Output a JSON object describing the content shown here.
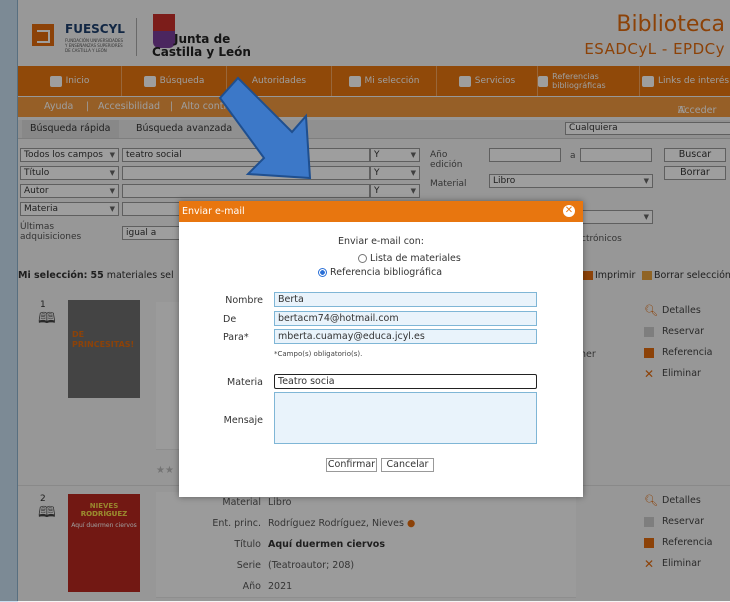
{
  "header": {
    "fues_name": "FUESCYL",
    "fues_sub": "FUNDACIÓN UNIVERSIDADES Y ENSEÑANZAS SUPERIORES DE CASTILLA Y LEÓN",
    "jcyl_line1": "Junta de",
    "jcyl_line2": "Castilla y León",
    "title": "Biblioteca",
    "subtitle": "ESADCyL - EPDCy"
  },
  "nav": {
    "items": [
      {
        "label": "Inicio",
        "icon": "home-icon"
      },
      {
        "label": "Búsqueda",
        "icon": "search-icon"
      },
      {
        "label": "Autoridades",
        "icon": "user-icon"
      },
      {
        "label": "Mi selección",
        "icon": "basket-icon"
      },
      {
        "label": "Servicios",
        "icon": "services-icon"
      },
      {
        "label": "Referencias bibliográficas",
        "icon": "books-icon"
      },
      {
        "label": "Links de interés",
        "icon": "globe-icon"
      }
    ]
  },
  "subnav": {
    "help": "Ayuda",
    "access": "Accesibilidad",
    "contrast": "Alto contraste",
    "login": "Acceder"
  },
  "search": {
    "tab_quick": "Búsqueda rápida",
    "tab_advanced": "Búsqueda avanzada",
    "quick_select": "Cualquiera",
    "fields": [
      "Todos los campos",
      "Título",
      "Autor",
      "Materia"
    ],
    "first_value": "teatro social",
    "op": "Y",
    "year_label": "Año edición",
    "year_sep": "a",
    "material_label": "Material",
    "material_value": "Libro",
    "search_button": "Buscar",
    "clear_button": "Borrar",
    "recent_label": "Últimas adquisiciones",
    "recent_value": "igual a",
    "electronic_partial": "ctrónicos"
  },
  "selection": {
    "label": "Mi selección:",
    "count": "55",
    "rest": "materiales sel",
    "print": "Imprimir",
    "clear": "Borrar selección"
  },
  "records": [
    {
      "num": "1",
      "cover_line1": "PRINCESITAS!",
      "cover_line2": "DE",
      "partial_right": "ner",
      "actions": [
        "Detalles",
        "Reservar",
        "Referencia",
        "Eliminar"
      ]
    },
    {
      "num": "2",
      "cover_line1": "NIEVES RODRÍGUEZ",
      "cover_line2": "RODRÍGUEZ",
      "cover_line3": "Aquí duermen ciervos",
      "meta": [
        {
          "k": "Material",
          "v": "Libro"
        },
        {
          "k": "Ent. princ.",
          "v": "Rodríguez Rodríguez, Nieves"
        },
        {
          "k": "Título",
          "v": "Aquí duermen ciervos"
        },
        {
          "k": "Serie",
          "v": "(Teatroautor; 208)"
        },
        {
          "k": "Año",
          "v": "2021"
        }
      ],
      "actions": [
        "Detalles",
        "Reservar",
        "Referencia",
        "Eliminar"
      ]
    }
  ],
  "dialog": {
    "title": "Enviar e-mail",
    "send_with": "Enviar e-mail con:",
    "option_list": "Lista de materiales",
    "option_ref": "Referencia bibliográfica",
    "selected_option": "Referencia bibliográfica",
    "name_label": "Nombre",
    "name_value": "Berta",
    "from_label": "De",
    "from_value": "bertacm74@hotmail.com",
    "to_label": "Para*",
    "to_value": "mberta.cuamay@educa.jcyl.es",
    "required_note": "*Campo(s) obligatorio(s).",
    "subject_label": "Materia",
    "subject_value": "Teatro socia",
    "message_label": "Mensaje",
    "message_value": "",
    "confirm": "Confirmar",
    "cancel": "Cancelar"
  },
  "colors": {
    "orange": "#e8760f",
    "orange_light": "#f39a3f",
    "arrow_blue": "#3c78c8"
  }
}
